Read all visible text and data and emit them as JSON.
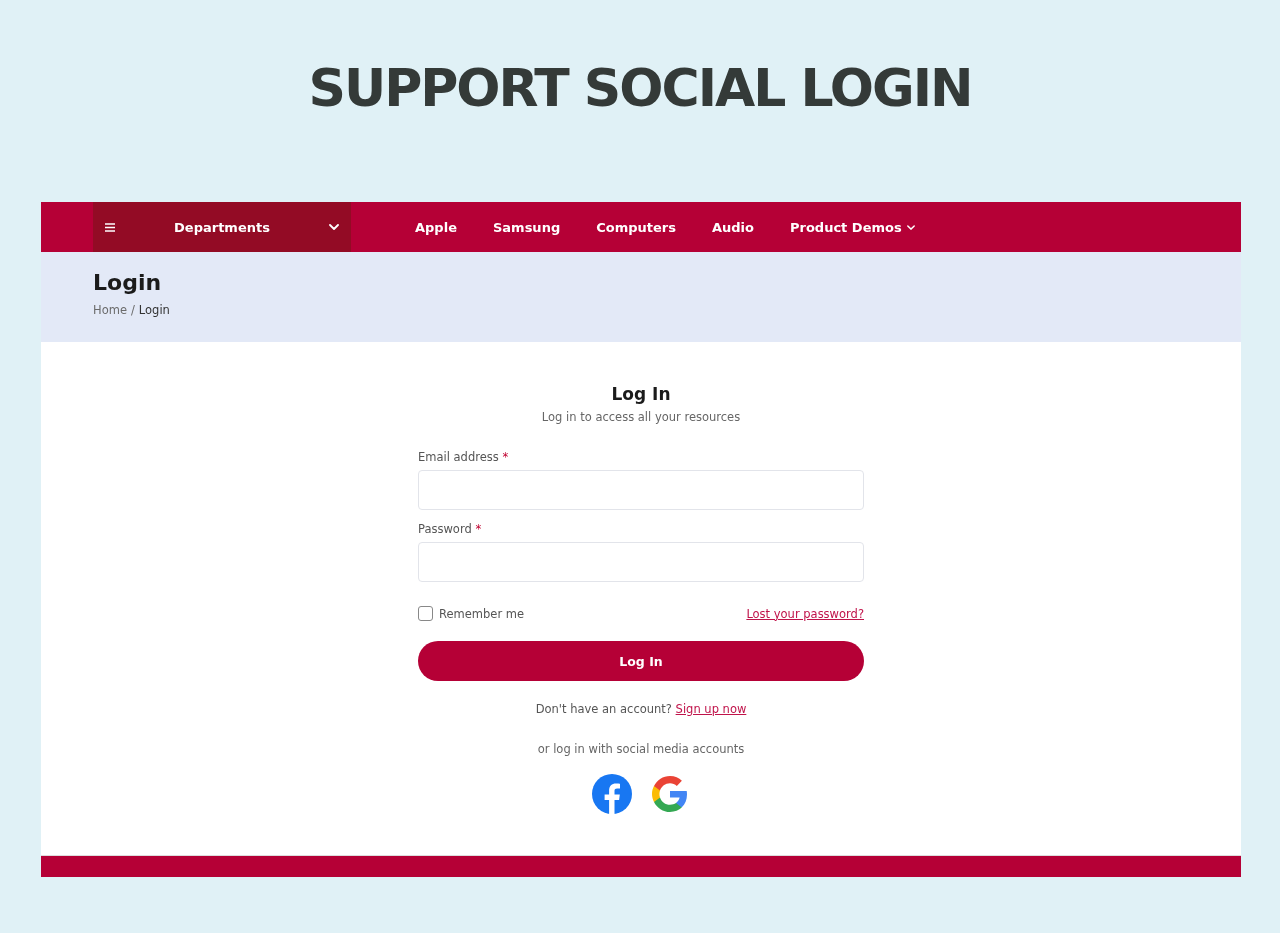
{
  "headline": "SUPPORT SOCIAL LOGIN",
  "nav": {
    "departments": {
      "label": "Departments"
    },
    "items": [
      {
        "label": "Apple",
        "has_dropdown": false
      },
      {
        "label": "Samsung",
        "has_dropdown": false
      },
      {
        "label": "Computers",
        "has_dropdown": false
      },
      {
        "label": "Audio",
        "has_dropdown": false
      },
      {
        "label": "Product Demos",
        "has_dropdown": true
      }
    ]
  },
  "page_header": {
    "title": "Login",
    "separator": "/",
    "breadcrumb": [
      {
        "label": "Home",
        "current": false
      },
      {
        "label": "Login",
        "current": true
      }
    ]
  },
  "form": {
    "title": "Log In",
    "subtitle": "Log in to access all your resources",
    "fields": [
      {
        "label": "Email address",
        "required_mark": "*"
      },
      {
        "label": "Password",
        "required_mark": "*"
      }
    ],
    "remember": {
      "label": "Remember me",
      "checked": false
    },
    "lost_password": "Lost your password?",
    "submit": "Log In",
    "signup_prompt": "Don't have an account?",
    "signup_link": "Sign up now",
    "social_prompt": "or log in with social media accounts",
    "social": [
      {
        "kind": "facebook"
      },
      {
        "kind": "google"
      }
    ]
  }
}
